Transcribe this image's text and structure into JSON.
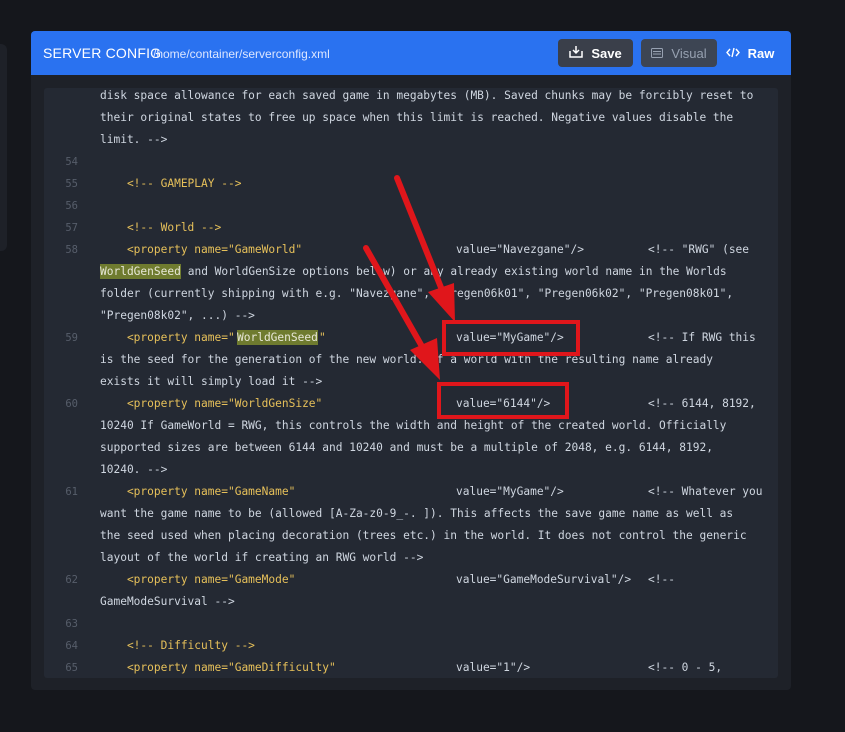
{
  "header": {
    "title": "SERVER CONFIG",
    "path": "/home/container/serverconfig.xml",
    "save_label": "Save",
    "visual_label": "Visual",
    "raw_label": "Raw"
  },
  "editor": {
    "lines": [
      {
        "num": "",
        "text": "disk space allowance for each saved game in megabytes (MB). Saved chunks may be forcibly reset to"
      },
      {
        "num": "",
        "text": "their original states to free up space when this limit is reached. Negative values disable the"
      },
      {
        "num": "",
        "text": "limit. -->"
      },
      {
        "num": "54",
        "text": ""
      },
      {
        "num": "55",
        "text": "    <!-- GAMEPLAY -->"
      },
      {
        "num": "56",
        "text": ""
      },
      {
        "num": "57",
        "text": "    <!-- World -->"
      },
      {
        "num": "58",
        "text_a": "    <property name=\"GameWorld\"",
        "text_b": "value=\"Navezgane\"/>",
        "text_c": "<!-- \"RWG\" (see"
      },
      {
        "num": "",
        "text_hl": "WorldGenSeed",
        "text": " and WorldGenSize options below) or any already existing world name in the Worlds"
      },
      {
        "num": "",
        "text": "folder (currently shipping with e.g. \"Navezgane\", \"Pregen06k01\", \"Pregen06k02\", \"Pregen08k01\","
      },
      {
        "num": "",
        "text": "\"Pregen08k02\", ...) -->"
      },
      {
        "num": "59",
        "text_a": "    <property name=\"",
        "text_hl": "WorldGenSeed",
        "text_a2": "\"",
        "text_b": "value=\"MyGame\"/>",
        "text_c": "<!-- If RWG this"
      },
      {
        "num": "",
        "text": "is the seed for the generation of the new world. If a world with the resulting name already"
      },
      {
        "num": "",
        "text": "exists it will simply load it -->"
      },
      {
        "num": "60",
        "text_a": "    <property name=\"WorldGenSize\"",
        "text_b": "value=\"6144\"/>",
        "text_c": "<!-- 6144, 8192,"
      },
      {
        "num": "",
        "text": "10240 If GameWorld = RWG, this controls the width and height of the created world. Officially"
      },
      {
        "num": "",
        "text": "supported sizes are between 6144 and 10240 and must be a multiple of 2048, e.g. 6144, 8192,"
      },
      {
        "num": "",
        "text": "10240. -->"
      },
      {
        "num": "61",
        "text_a": "    <property name=\"GameName\"",
        "text_b": "value=\"MyGame\"/>",
        "text_c": "<!-- Whatever you"
      },
      {
        "num": "",
        "text": "want the game name to be (allowed [A-Za-z0-9_-. ]). This affects the save game name as well as"
      },
      {
        "num": "",
        "text": "the seed used when placing decoration (trees etc.) in the world. It does not control the generic"
      },
      {
        "num": "",
        "text": "layout of the world if creating an RWG world -->"
      },
      {
        "num": "62",
        "text_a": "    <property name=\"GameMode\"",
        "text_b": "value=\"GameModeSurvival\"/>",
        "text_c": "<!--"
      },
      {
        "num": "",
        "text": "GameModeSurvival -->"
      },
      {
        "num": "63",
        "text": ""
      },
      {
        "num": "64",
        "text": "    <!-- Difficulty -->"
      },
      {
        "num": "65",
        "text_a": "    <property name=\"GameDifficulty\"",
        "text_b": "value=\"1\"/>",
        "text_c": "<!-- 0 - 5,"
      }
    ]
  },
  "colors": {
    "header_bg": "#2a72f0",
    "highlight": "#6f7b2f",
    "annotation_red": "#e0161b"
  },
  "icons": [
    "save-icon",
    "visual-icon",
    "code-icon"
  ]
}
